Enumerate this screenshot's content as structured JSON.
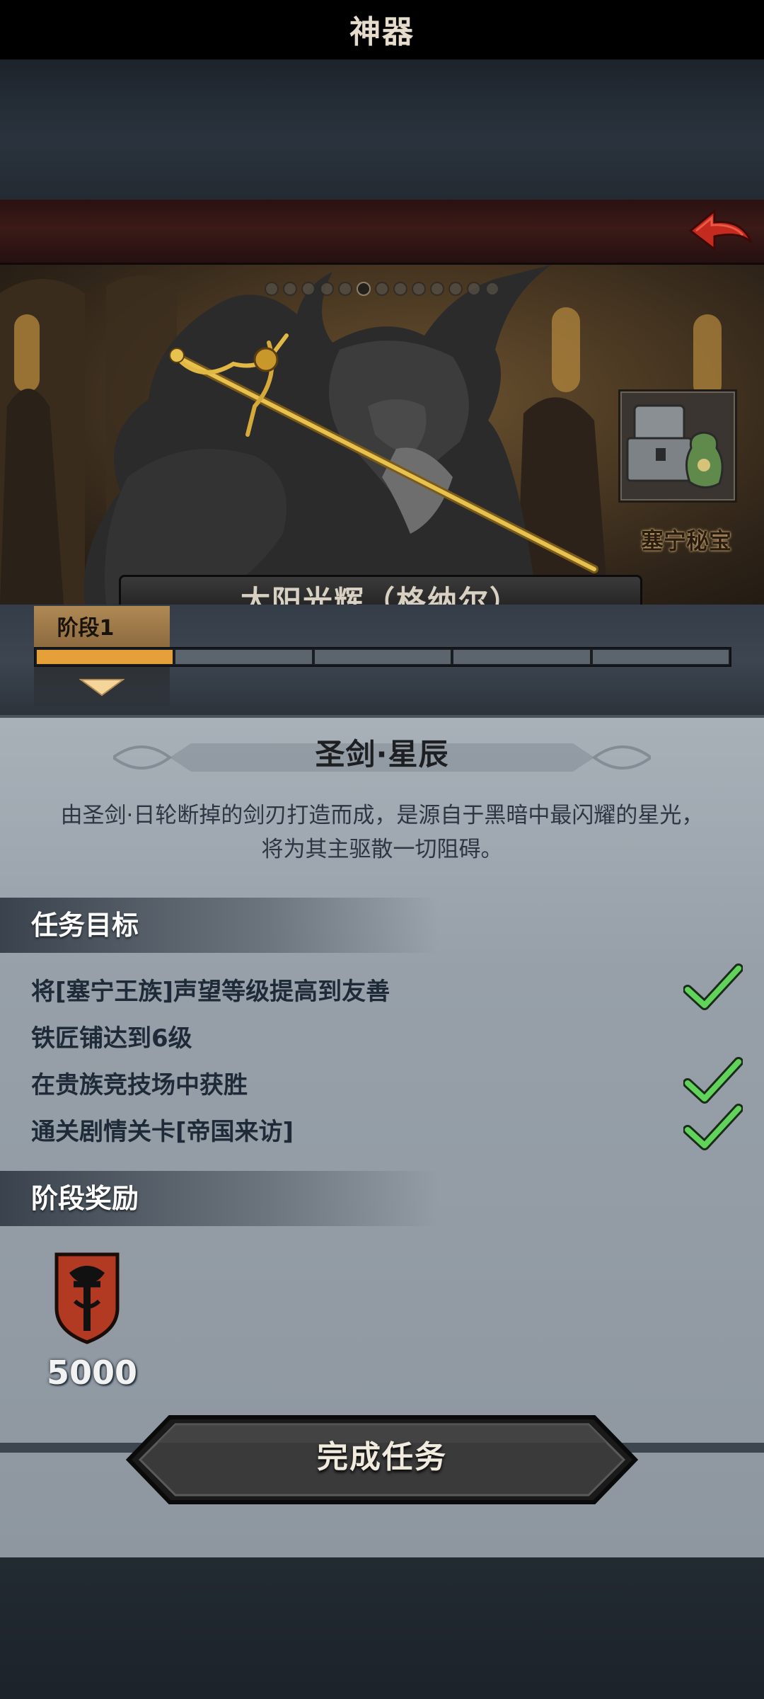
{
  "header": {
    "title": "神器"
  },
  "hero": {
    "treasure_label": "塞宁秘宝",
    "subtitle": "太阳光辉（格纳尔）",
    "page_dots": 13,
    "active_dot": 5
  },
  "stage": {
    "tab_label": "阶段1",
    "segments_total": 5,
    "segments_done": 1
  },
  "artifact": {
    "name": "圣剑·星辰",
    "description_line1": "由圣剑·日轮断掉的剑刃打造而成，是源自于黑暗中最闪耀的星光，",
    "description_line2": "将为其主驱散一切阻碍。"
  },
  "tasks": {
    "title": "任务目标",
    "items": [
      {
        "text": "将[塞宁王族]声望等级提高到友善",
        "completed": true
      },
      {
        "text": "铁匠铺达到6级",
        "completed": false
      },
      {
        "text": "在贵族竞技场中获胜",
        "completed": true
      },
      {
        "text": "通关剧情关卡[帝国来访]",
        "completed": true
      }
    ]
  },
  "rewards": {
    "title": "阶段奖励",
    "items": [
      {
        "icon": "crimson-shield-emblem-icon",
        "value": "5000"
      }
    ]
  },
  "complete_button": {
    "label": "完成任务"
  },
  "colors": {
    "accent": "#e6a03a",
    "check": "#5fd35a",
    "header": "#3b1a17"
  }
}
